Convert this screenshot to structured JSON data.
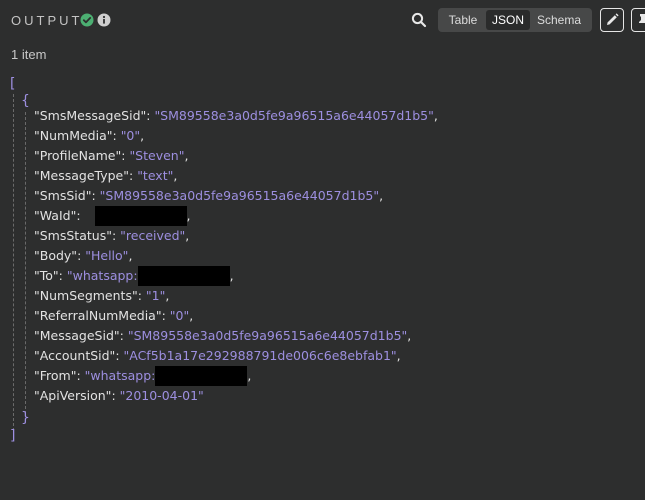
{
  "header": {
    "title": "OUTPUT",
    "views": [
      {
        "label": "Table"
      },
      {
        "label": "JSON"
      },
      {
        "label": "Schema"
      }
    ]
  },
  "item_count": "1 item",
  "json": {
    "open_bracket": "[",
    "close_bracket": "]",
    "open_brace": "{",
    "close_brace": "}",
    "entries": [
      {
        "key": "\"SmsMessageSid\"",
        "value": "\"SM89558e3a0d5fe9a96515a6e44057d1b5\""
      },
      {
        "key": "\"NumMedia\"",
        "value": "\"0\""
      },
      {
        "key": "\"ProfileName\"",
        "value": "\"Steven\""
      },
      {
        "key": "\"MessageType\"",
        "value": "\"text\""
      },
      {
        "key": "\"SmsSid\"",
        "value": "\"SM89558e3a0d5fe9a96515a6e44057d1b5\""
      },
      {
        "key": "\"WaId\"",
        "value": ""
      },
      {
        "key": "\"SmsStatus\"",
        "value": "\"received\""
      },
      {
        "key": "\"Body\"",
        "value": "\"Hello\""
      },
      {
        "key": "\"To\"",
        "value": "\"whatsapp:"
      },
      {
        "key": "\"NumSegments\"",
        "value": "\"1\""
      },
      {
        "key": "\"ReferralNumMedia\"",
        "value": "\"0\""
      },
      {
        "key": "\"MessageSid\"",
        "value": "\"SM89558e3a0d5fe9a96515a6e44057d1b5\""
      },
      {
        "key": "\"AccountSid\"",
        "value": "\"ACf5b1a17e292988791de006c6e8ebfab1\""
      },
      {
        "key": "\"From\"",
        "value": "\"whatsapp:"
      },
      {
        "key": "\"ApiVersion\"",
        "value": "\"2010-04-01\""
      }
    ]
  },
  "colors": {
    "background": "#2d2e2e",
    "string_value": "#9d8fe0",
    "success": "#4caf72"
  },
  "icons": [
    "check-circle-icon",
    "info-icon",
    "search-icon",
    "pencil-icon",
    "pin-icon"
  ]
}
